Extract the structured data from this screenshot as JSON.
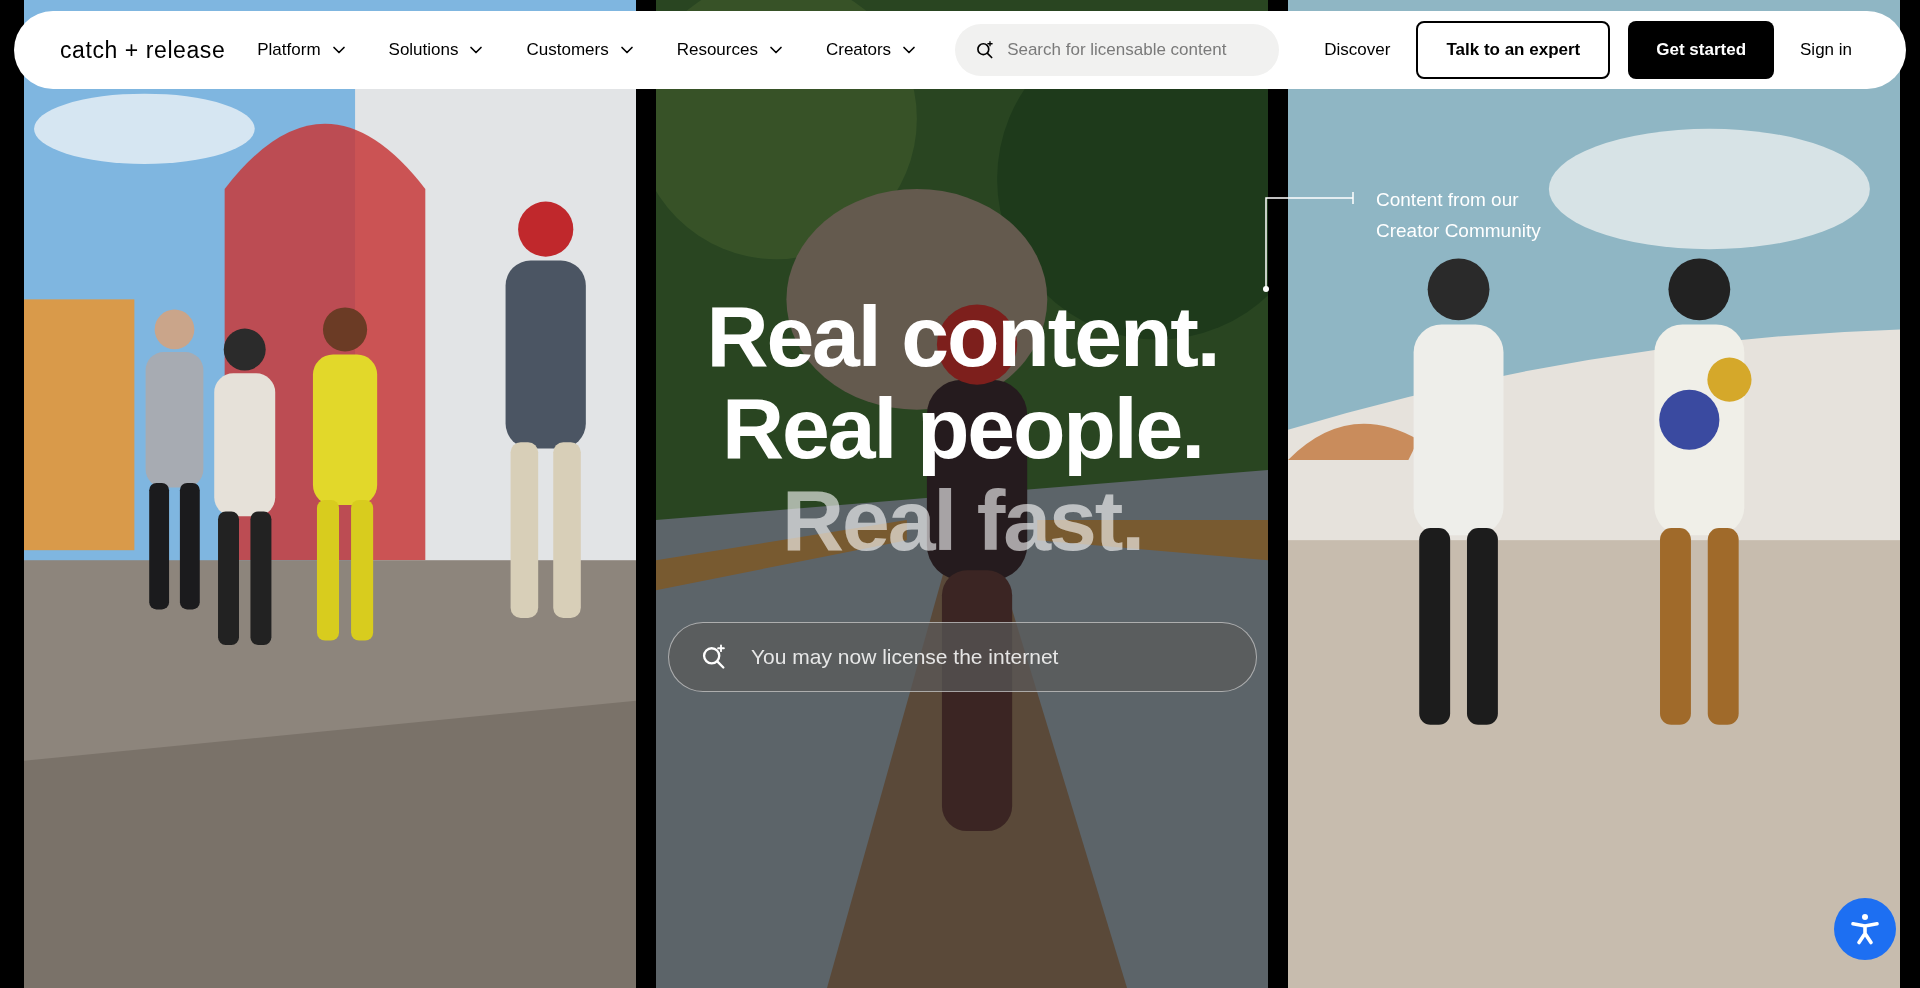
{
  "nav": {
    "logo": "catch + release",
    "menu": [
      {
        "label": "Platform"
      },
      {
        "label": "Solutions"
      },
      {
        "label": "Customers"
      },
      {
        "label": "Resources"
      },
      {
        "label": "Creators"
      }
    ],
    "search": {
      "placeholder": "Search for licensable content"
    },
    "actions": [
      {
        "kind": "link",
        "label": "Discover"
      },
      {
        "kind": "outline",
        "label": "Talk to an expert"
      },
      {
        "kind": "filled",
        "label": "Get started"
      },
      {
        "kind": "link",
        "label": "Sign in"
      }
    ]
  },
  "hero": {
    "headline": [
      {
        "text": "Real content.",
        "faded": false
      },
      {
        "text": "Real people.",
        "faded": false
      },
      {
        "text": "Real fast.",
        "faded": true
      }
    ],
    "search": {
      "placeholder": "You may now license the internet"
    },
    "callout": "Content from our Creator Community"
  }
}
